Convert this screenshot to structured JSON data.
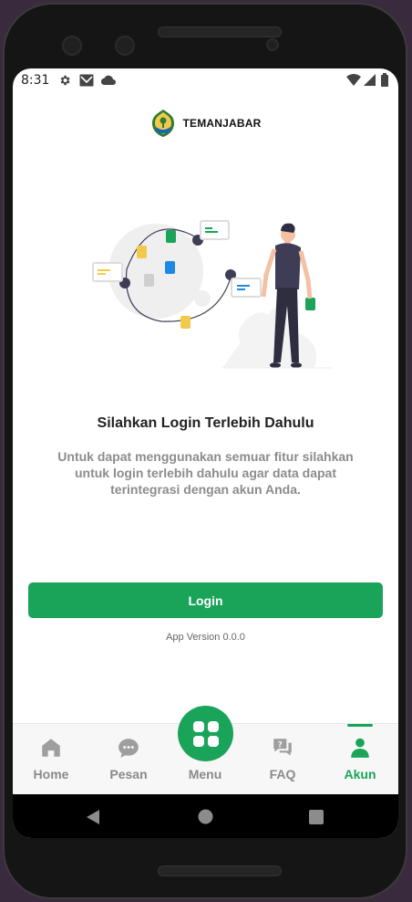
{
  "statusbar": {
    "time": "8:31"
  },
  "header": {
    "brand": "TEMANJABAR"
  },
  "main": {
    "title": "Silahkan Login Terlebih Dahulu",
    "description": "Untuk dapat menggunakan semuar fitur silahkan untuk login terlebih dahulu agar data dapat terintegrasi dengan akun Anda.",
    "login_label": "Login",
    "version": "App Version 0.0.0"
  },
  "bottomnav": {
    "items": [
      {
        "label": "Home",
        "icon": "home-icon"
      },
      {
        "label": "Pesan",
        "icon": "chat-bubble-icon"
      },
      {
        "label": "Menu",
        "icon": "grid-icon"
      },
      {
        "label": "FAQ",
        "icon": "question-chat-icon"
      },
      {
        "label": "Akun",
        "icon": "person-icon",
        "active": true
      }
    ]
  },
  "colors": {
    "accent": "#1aa45a",
    "frame": "#151515",
    "inactive": "#8a8a8a"
  }
}
